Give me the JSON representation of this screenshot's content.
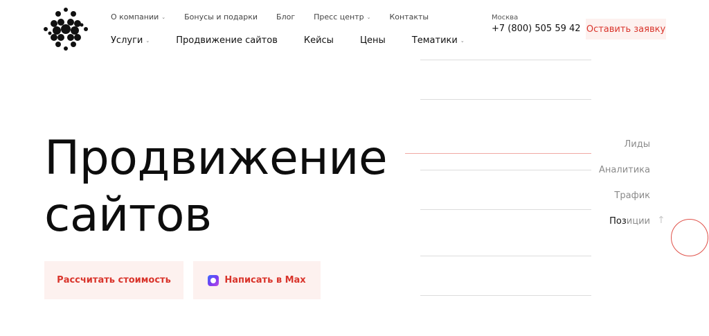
{
  "brand": {
    "logo_icon": "molecule-logo-icon"
  },
  "top_nav": [
    {
      "label": "О компании",
      "has_dropdown": true
    },
    {
      "label": "Бонусы и подарки",
      "has_dropdown": false
    },
    {
      "label": "Блог",
      "has_dropdown": false
    },
    {
      "label": "Пресс центр",
      "has_dropdown": true
    },
    {
      "label": "Контакты",
      "has_dropdown": false
    }
  ],
  "main_nav": [
    {
      "label": "Услуги",
      "has_dropdown": true
    },
    {
      "label": "Продвижение сайтов",
      "has_dropdown": false
    },
    {
      "label": "Кейсы",
      "has_dropdown": false
    },
    {
      "label": "Цены",
      "has_dropdown": false
    },
    {
      "label": "Тематики",
      "has_dropdown": true
    }
  ],
  "contact": {
    "city": "Москва",
    "phone": "+7 (800) 505 59 42"
  },
  "cta_top": {
    "label": "Оставить заявку"
  },
  "hero": {
    "title_line1": "Продвижение",
    "title_line2": "сайтов",
    "calc_button": "Рассчитать стоимость",
    "msg_button": "Написать в Max",
    "msg_icon": "max-messenger-icon"
  },
  "metrics": {
    "leads": "Лиды",
    "analytics": "Аналитика",
    "traffic": "Трафик",
    "positions_dark": "Поз",
    "positions_light": "иции",
    "arrow_icon": "arrow-up-icon"
  },
  "colors": {
    "accent": "#d9342b",
    "button_bg": "#fdf1ef",
    "ring": "#e0524a"
  }
}
